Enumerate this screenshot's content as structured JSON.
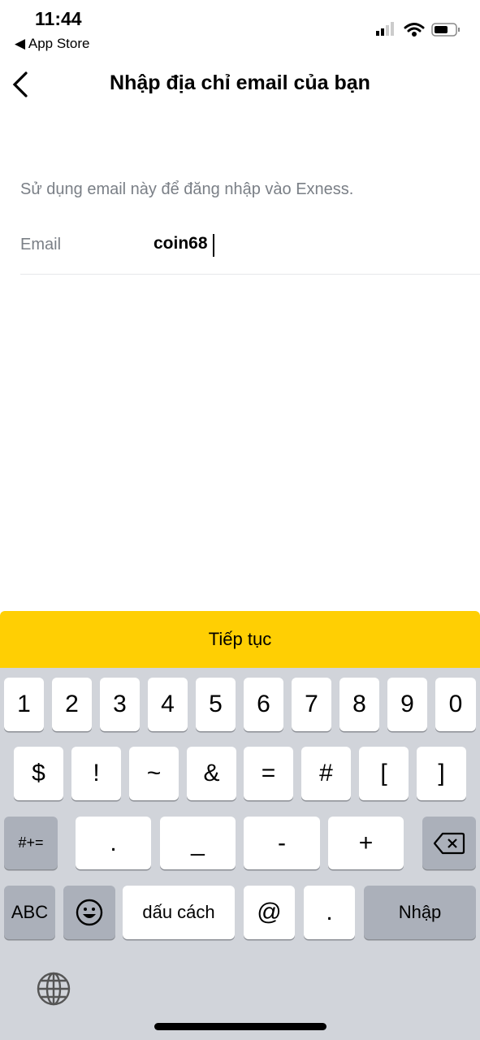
{
  "status_bar": {
    "time": "11:44",
    "back_app": "◀ App Store"
  },
  "header": {
    "title": "Nhập địa chỉ email của bạn"
  },
  "form": {
    "hint": "Sử dụng email này để đăng nhập vào Exness.",
    "email_label": "Email",
    "email_value": "coin68"
  },
  "continue_label": "Tiếp tục",
  "colors": {
    "accent": "#ffcf03",
    "keyboard_bg": "#d1d4da"
  },
  "keyboard": {
    "row1": [
      "1",
      "2",
      "3",
      "4",
      "5",
      "6",
      "7",
      "8",
      "9",
      "0"
    ],
    "row2": [
      "$",
      "!",
      "~",
      "&",
      "=",
      "#",
      "[",
      "]"
    ],
    "row3": [
      "#+=",
      ".",
      "_",
      "-",
      "+",
      "delete-icon"
    ],
    "row4": [
      "ABC",
      "emoji-icon",
      "dấu cách",
      "@",
      ".",
      "Nhập"
    ],
    "globe": "globe-icon"
  }
}
